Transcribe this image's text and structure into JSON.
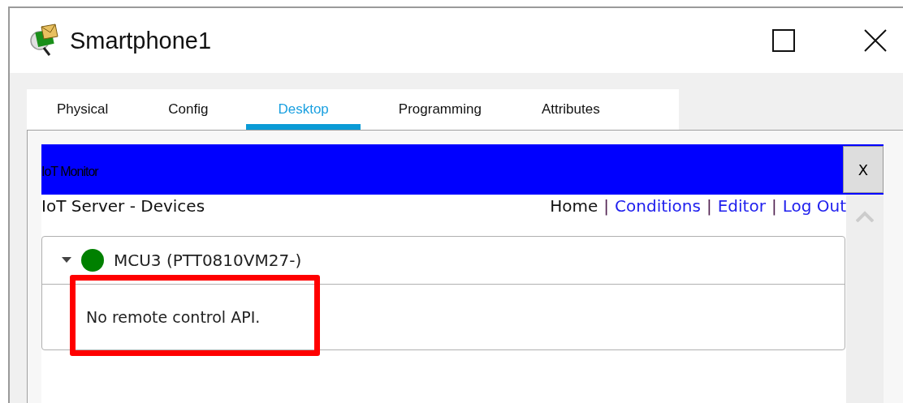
{
  "window": {
    "title": "Smartphone1"
  },
  "tabs": [
    {
      "label": "Physical",
      "selected": false
    },
    {
      "label": "Config",
      "selected": false
    },
    {
      "label": "Desktop",
      "selected": true
    },
    {
      "label": "Programming",
      "selected": false
    },
    {
      "label": "Attributes",
      "selected": false
    }
  ],
  "app": {
    "title": "IoT Monitor",
    "close": "X",
    "heading": "IoT Server - Devices",
    "nav": [
      {
        "label": "Home",
        "selected": true
      },
      {
        "label": "Conditions",
        "selected": false
      },
      {
        "label": "Editor",
        "selected": false
      },
      {
        "label": "Log Out",
        "selected": false
      }
    ],
    "separator": "|",
    "devices": [
      {
        "name": "MCU3 (PTT0810VM27-)",
        "expanded": true,
        "color": "#008000",
        "message": "No remote control API.",
        "highlighted": true
      }
    ]
  }
}
